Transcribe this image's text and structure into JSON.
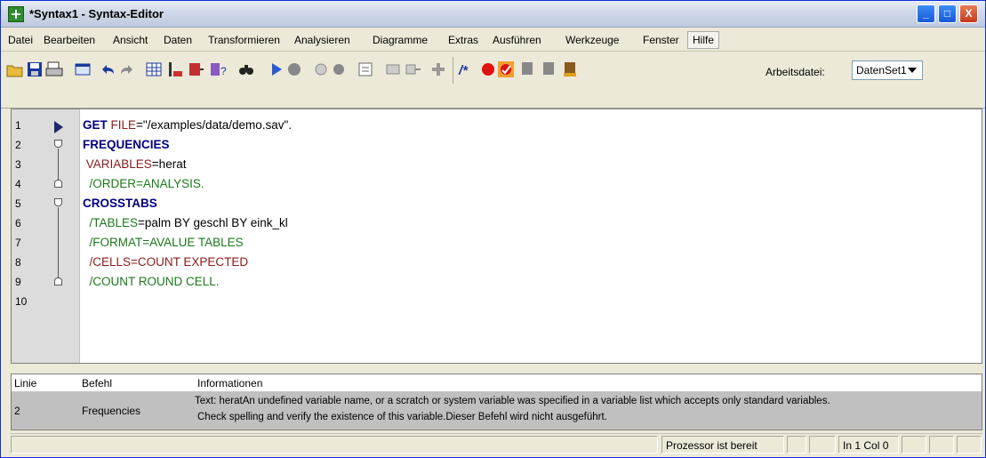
{
  "window": {
    "title": "*Syntax1 - Syntax-Editor",
    "minimize": "_",
    "maximize": "□",
    "close": "X"
  },
  "menu": [
    "Datei",
    "Bearbeiten",
    "Ansicht",
    "Daten",
    "Transformieren",
    "Analysieren",
    "Diagramme",
    "Extras",
    "Ausführen",
    "Werkzeuge",
    "Fenster",
    "Hilfe"
  ],
  "toolbar": {
    "arbeitsdatei_label": "Arbeitsdatei:",
    "dataset_value": "DatenSet1",
    "icons": [
      "open-icon",
      "save-icon",
      "print-icon",
      "dialog-recall-icon",
      "undo-icon",
      "redo-icon",
      "goto-data-icon",
      "goto-case-icon",
      "variables-icon",
      "variable-info-icon",
      "find-icon",
      "run-icon",
      "stop-icon",
      "show-icon",
      "hide-icon",
      "goto-line-icon",
      "autocomplete-icon",
      "next-error-icon",
      "color-icon",
      "comment-icon",
      "breakpoint-icon",
      "bookmark-icon",
      "toggle-bookmark-icon",
      "next-bookmark-icon",
      "clear-bookmark-icon"
    ]
  },
  "editor": {
    "line_numbers": [
      "1",
      "2",
      "3",
      "4",
      "5",
      "6",
      "7",
      "8",
      "9",
      "10"
    ],
    "lines": [
      {
        "kw": "GET",
        "sub": " FILE",
        "val": "=\"/examples/data/demo.sav\"."
      },
      {
        "kw": "FREQUENCIES",
        "sub": "",
        "val": ""
      },
      {
        "kw": "",
        "sub": " VARIABLES",
        "val": "=herat"
      },
      {
        "kw": "",
        "sub": "  /ORDER=ANALYSIS.",
        "val": ""
      },
      {
        "kw": "CROSSTABS",
        "sub": "",
        "val": ""
      },
      {
        "kw": "",
        "sub": "  /TABLES",
        "val": "=palm BY geschl BY eink_kl"
      },
      {
        "kw": "",
        "sub": "  /FORMAT=AVALUE TABLES",
        "val": ""
      },
      {
        "kw": "",
        "sub": "  /CELLS=COUNT EXPECTED",
        "val": ""
      },
      {
        "kw": "",
        "sub": "  /COUNT ROUND CELL.",
        "val": ""
      },
      {
        "kw": "",
        "sub": "",
        "val": ""
      }
    ]
  },
  "messages": {
    "headers": {
      "linie": "Linie",
      "befehl": "Befehl",
      "info": "Informationen"
    },
    "row": {
      "linie": "2",
      "befehl": "Frequencies",
      "info_line1": "Text: heratAn undefined variable name, or a scratch or system variable was specified in a variable list which accepts only standard variables.",
      "info_line2": "Check spelling and verify the existence of this variable.Dieser Befehl wird nicht ausgeführt."
    }
  },
  "status": {
    "processor": "Prozessor ist bereit",
    "position": "In 1 Col 0"
  }
}
